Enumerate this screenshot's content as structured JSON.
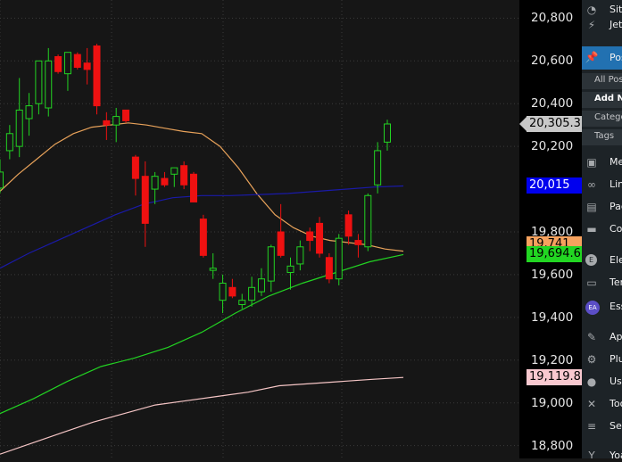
{
  "chart_data": {
    "type": "candlestick",
    "y_ticks": [
      "20,800",
      "20,600",
      "20,400",
      "20,200",
      "19,800",
      "19,600",
      "19,400",
      "19,200",
      "19,000",
      "18,800"
    ],
    "y_tick_values": [
      20800,
      20600,
      20400,
      20200,
      19800,
      19600,
      19400,
      19200,
      19000,
      18800
    ],
    "ylim": [
      18740,
      20885
    ],
    "grid": true,
    "candles": [
      {
        "o": 20005,
        "h": 20140,
        "l": 19980,
        "c": 20080
      },
      {
        "o": 20180,
        "h": 20300,
        "l": 20140,
        "c": 20260
      },
      {
        "o": 20200,
        "h": 20520,
        "l": 20150,
        "c": 20370
      },
      {
        "o": 20330,
        "h": 20450,
        "l": 20250,
        "c": 20390
      },
      {
        "o": 20400,
        "h": 20600,
        "l": 20350,
        "c": 20600
      },
      {
        "o": 20380,
        "h": 20660,
        "l": 20340,
        "c": 20600
      },
      {
        "o": 20620,
        "h": 20630,
        "l": 20540,
        "c": 20550
      },
      {
        "o": 20540,
        "h": 20640,
        "l": 20460,
        "c": 20640
      },
      {
        "o": 20630,
        "h": 20640,
        "l": 20560,
        "c": 20570
      },
      {
        "o": 20590,
        "h": 20660,
        "l": 20490,
        "c": 20560
      },
      {
        "o": 20670,
        "h": 20680,
        "l": 20350,
        "c": 20390
      },
      {
        "o": 20320,
        "h": 20360,
        "l": 20230,
        "c": 20300
      },
      {
        "o": 20300,
        "h": 20380,
        "l": 20220,
        "c": 20340
      },
      {
        "o": 20370,
        "h": 20370,
        "l": 20310,
        "c": 20320
      },
      {
        "o": 20150,
        "h": 20160,
        "l": 19970,
        "c": 20050
      },
      {
        "o": 20060,
        "h": 20130,
        "l": 19730,
        "c": 19840
      },
      {
        "o": 20000,
        "h": 20080,
        "l": 19930,
        "c": 20060
      },
      {
        "o": 20050,
        "h": 20080,
        "l": 20010,
        "c": 20020
      },
      {
        "o": 20070,
        "h": 20100,
        "l": 20010,
        "c": 20100
      },
      {
        "o": 20110,
        "h": 20130,
        "l": 20000,
        "c": 20020
      },
      {
        "o": 20070,
        "h": 20080,
        "l": 19940,
        "c": 19940
      },
      {
        "o": 19860,
        "h": 19880,
        "l": 19680,
        "c": 19690
      },
      {
        "o": 19620,
        "h": 19700,
        "l": 19580,
        "c": 19630
      },
      {
        "o": 19480,
        "h": 19600,
        "l": 19420,
        "c": 19560
      },
      {
        "o": 19540,
        "h": 19580,
        "l": 19490,
        "c": 19500
      },
      {
        "o": 19460,
        "h": 19510,
        "l": 19440,
        "c": 19480
      },
      {
        "o": 19480,
        "h": 19590,
        "l": 19450,
        "c": 19540
      },
      {
        "o": 19520,
        "h": 19630,
        "l": 19500,
        "c": 19580
      },
      {
        "o": 19570,
        "h": 19740,
        "l": 19520,
        "c": 19730
      },
      {
        "o": 19800,
        "h": 19930,
        "l": 19680,
        "c": 19690
      },
      {
        "o": 19610,
        "h": 19680,
        "l": 19530,
        "c": 19640
      },
      {
        "o": 19650,
        "h": 19760,
        "l": 19620,
        "c": 19730
      },
      {
        "o": 19800,
        "h": 19820,
        "l": 19710,
        "c": 19760
      },
      {
        "o": 19840,
        "h": 19870,
        "l": 19680,
        "c": 19700
      },
      {
        "o": 19680,
        "h": 19700,
        "l": 19560,
        "c": 19580
      },
      {
        "o": 19580,
        "h": 19790,
        "l": 19550,
        "c": 19770
      },
      {
        "o": 19880,
        "h": 19900,
        "l": 19740,
        "c": 19780
      },
      {
        "o": 19760,
        "h": 19790,
        "l": 19680,
        "c": 19740
      },
      {
        "o": 19730,
        "h": 19980,
        "l": 19710,
        "c": 19970
      },
      {
        "o": 20020,
        "h": 20220,
        "l": 19980,
        "c": 20180
      },
      {
        "o": 20220,
        "h": 20325,
        "l": 20180,
        "c": 20305
      }
    ],
    "series": [
      {
        "color": "#e8a25a",
        "values": [
          19990,
          20070,
          20140,
          20210,
          20260,
          20290,
          20300,
          20310,
          20300,
          20285,
          20270,
          20260,
          20200,
          20100,
          19980,
          19880,
          19820,
          19780,
          19760,
          19750,
          19740,
          19720,
          19710
        ]
      },
      {
        "color": "#1a1aa8",
        "values": [
          19630,
          19700,
          19760,
          19820,
          19880,
          19930,
          19960,
          19970,
          19970,
          19975,
          19980,
          19990,
          20000,
          20010,
          20015
        ]
      },
      {
        "color": "#22d322",
        "values": [
          18950,
          19020,
          19100,
          19170,
          19210,
          19260,
          19330,
          19420,
          19500,
          19560,
          19610,
          19660,
          19694
        ]
      },
      {
        "color": "#f5c5c5",
        "values": [
          18760,
          18810,
          18860,
          18910,
          18950,
          18990,
          19010,
          19030,
          19050,
          19080,
          19090,
          19100,
          19110,
          19119
        ]
      }
    ],
    "price_tags": [
      {
        "label": "20,305.3",
        "value": 20305.3,
        "bg": "#c8c8c8",
        "fg": "#000000"
      },
      {
        "label": "20,015",
        "value": 20015,
        "bg": "#0000ee",
        "fg": "#ffffff"
      },
      {
        "label": "19,741",
        "value": 19741,
        "bg": "#f7a25e",
        "fg": "#000000"
      },
      {
        "label": "19,694.6",
        "value": 19694.6,
        "bg": "#22d622",
        "fg": "#000000"
      },
      {
        "label": "19,119.8",
        "value": 19119.8,
        "bg": "#f8c8cf",
        "fg": "#000000"
      }
    ],
    "colors": {
      "up": "#22d322",
      "down": "#ee1111",
      "grid": "#3a3a3a",
      "background": "#161616"
    }
  },
  "sidebar": {
    "items": [
      {
        "label": "Site",
        "icon": "gauge-icon"
      },
      {
        "label": "Jetpack",
        "icon": "jetpack-icon"
      },
      {
        "label": "Posts",
        "icon": "pin-icon",
        "active": true
      },
      {
        "label": "All Posts",
        "sub": true
      },
      {
        "label": "Add New",
        "sub": true,
        "bold": true
      },
      {
        "label": "Categories",
        "sub": true
      },
      {
        "label": "Tags",
        "sub": true
      },
      {
        "label": "Media",
        "icon": "media-icon"
      },
      {
        "label": "Links",
        "icon": "link-icon"
      },
      {
        "label": "Pages",
        "icon": "page-icon"
      },
      {
        "label": "Comments",
        "icon": "comment-icon"
      },
      {
        "label": "Elementor",
        "icon": "elementor-icon"
      },
      {
        "label": "Templates",
        "icon": "folder-icon"
      },
      {
        "label": "Essential Addons",
        "icon": "ea-icon"
      },
      {
        "label": "Appearance",
        "icon": "brush-icon"
      },
      {
        "label": "Plugins",
        "icon": "plugin-icon"
      },
      {
        "label": "Users",
        "icon": "user-icon"
      },
      {
        "label": "Tools",
        "icon": "wrench-icon"
      },
      {
        "label": "Settings",
        "icon": "settings-icon"
      },
      {
        "label": "Yoast SEO",
        "icon": "yoast-icon"
      }
    ]
  }
}
